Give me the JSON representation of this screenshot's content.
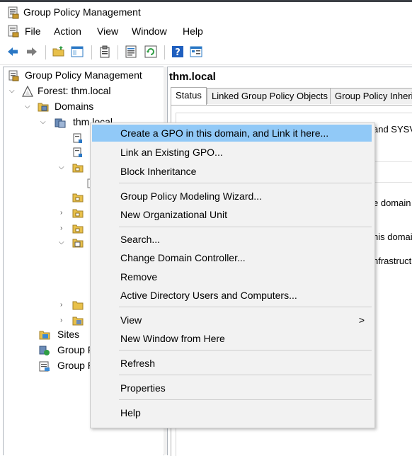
{
  "window": {
    "title": "Group Policy Management"
  },
  "menubar": {
    "items": [
      "File",
      "Action",
      "View",
      "Window",
      "Help"
    ]
  },
  "tree": {
    "root": "Group Policy Management",
    "forest": "Forest: thm.local",
    "domains": "Domains",
    "domain": "thm.local",
    "sites": "Sites",
    "modeling": "Group P",
    "results": "Group P"
  },
  "right_pane": {
    "title": "thm.local",
    "tabs": [
      "Status",
      "Linked Group Policy Objects",
      "Group Policy Inherit"
    ],
    "fragments": [
      "and SYSV",
      "e domain",
      "his domair",
      "nfrastructu"
    ]
  },
  "context_menu": {
    "items": [
      {
        "label": "Create a GPO in this domain, and Link it here...",
        "highlighted": true
      },
      {
        "label": "Link an Existing GPO..."
      },
      {
        "label": "Block Inheritance"
      },
      {
        "label": "Group Policy Modeling Wizard..."
      },
      {
        "label": "New Organizational Unit"
      },
      {
        "label": "Search..."
      },
      {
        "label": "Change Domain Controller..."
      },
      {
        "label": "Remove"
      },
      {
        "label": "Active Directory Users and Computers..."
      },
      {
        "label": "View",
        "submenu_arrow": ">"
      },
      {
        "label": "New Window from Here"
      },
      {
        "label": "Refresh"
      },
      {
        "label": "Properties"
      },
      {
        "label": "Help"
      }
    ]
  },
  "colors": {
    "highlight": "#91c9f7",
    "menu_bg": "#f2f2f2",
    "toolbar_blue": "#2b78c5",
    "folder": "#e8c04a"
  }
}
